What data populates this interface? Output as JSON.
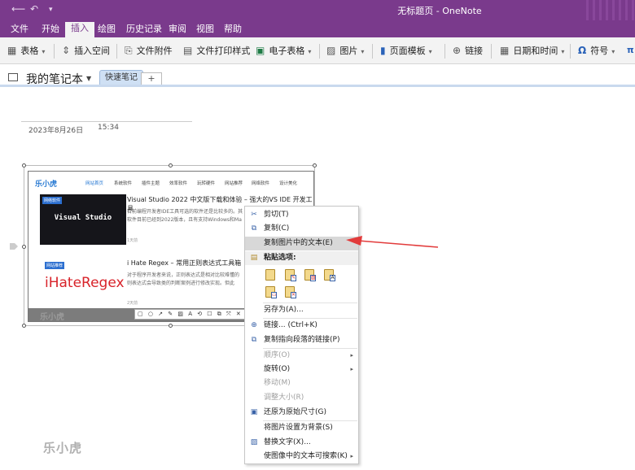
{
  "window": {
    "title": "无标题页 - OneNote"
  },
  "menu_tabs": [
    "文件",
    "开始",
    "插入",
    "绘图",
    "历史记录",
    "审阅",
    "视图",
    "帮助"
  ],
  "active_tab": "插入",
  "ribbon": {
    "table": "表格",
    "insert_space": "插入空间",
    "file_attachment": "文件附件",
    "file_printout": "文件打印样式",
    "spreadsheet": "电子表格",
    "pictures": "图片",
    "page_templates": "页面模板",
    "link": "链接",
    "date_time": "日期和时间",
    "symbol": "符号",
    "equation": "π"
  },
  "notebook": {
    "name": "我的笔记本",
    "section": "快速笔记",
    "add_tab": "+"
  },
  "page": {
    "date": "2023年8月26日",
    "time": "15:34"
  },
  "screenshot": {
    "logo": "乐小虎",
    "nav": [
      "网站首页",
      "系统软件",
      "插件主题",
      "效率软件",
      "玩转硬件",
      "网站推荐",
      "网络软件",
      "设计美化"
    ],
    "article1": {
      "tag": "网络软件",
      "card_text": "Visual Studio",
      "title": "Visual Studio 2022 中文版下载和体验 – 强大的VS IDE 开发工具",
      "desc1": "目前编程开发者IDE工具可选的软件还是比较多的。其",
      "desc2": "软件目前已经到2022版本，且有支持Windows和Ma",
      "date": "1天前"
    },
    "article2": {
      "tag": "网站推荐",
      "card_text": "iHateRegex",
      "title": "i Hate Regex – 常用正则表达式工具箱",
      "desc1": "对于程序开发者来说，正则表达式是相对比较难懂的",
      "desc2": "则表达式会导致类的判断案例进行修改实现。但此",
      "date": "2天前"
    },
    "watermark": "乐小虎",
    "snip_tools": "▢ ○ ↗ ✎ ▨ A ⟲ ☐ ⧉ ⤧ ✕"
  },
  "context_menu": {
    "cut": "剪切(T)",
    "copy": "复制(C)",
    "copy_text": "复制图片中的文本(E)",
    "paste_options": "粘贴选项:",
    "save_as": "另存为(A)...",
    "link": "链接... (Ctrl+K)",
    "copy_link": "复制指向段落的链接(P)",
    "order": "顺序(O)",
    "rotate": "旋转(O)",
    "move": "移动(M)",
    "resize": "调整大小(R)",
    "restore_size": "还原为原始尺寸(G)",
    "set_background": "将图片设置为背景(S)",
    "alt_text": "替换文字(X)...",
    "make_searchable": "使图像中的文本可搜索(K)"
  },
  "watermark": "乐小虎",
  "colors": {
    "accent": "#7a3a8c",
    "arrow": "#e23b3b"
  }
}
